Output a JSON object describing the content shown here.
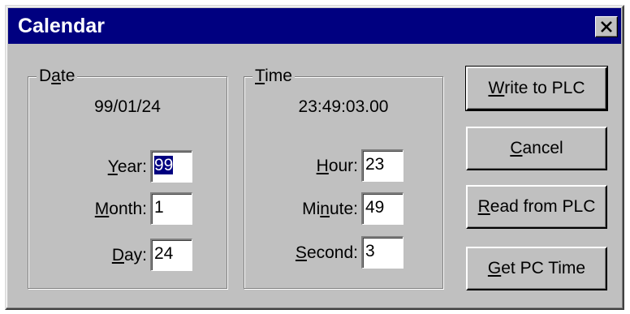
{
  "window": {
    "title": "Calendar"
  },
  "date_group": {
    "legend_prefix": "D",
    "legend_hotkey": "a",
    "legend_suffix": "te",
    "readout": "99/01/24",
    "fields": [
      {
        "label_pre": "",
        "hotkey": "Y",
        "label_post": "ear:",
        "value": "99"
      },
      {
        "label_pre": "",
        "hotkey": "M",
        "label_post": "onth:",
        "value": "1"
      },
      {
        "label_pre": "",
        "hotkey": "D",
        "label_post": "ay:",
        "value": "24"
      }
    ]
  },
  "time_group": {
    "legend_prefix": "",
    "legend_hotkey": "T",
    "legend_suffix": "ime",
    "readout": "23:49:03.00",
    "fields": [
      {
        "label_pre": "",
        "hotkey": "H",
        "label_post": "our:",
        "value": "23"
      },
      {
        "label_pre": "Mi",
        "hotkey": "n",
        "label_post": "ute:",
        "value": "49"
      },
      {
        "label_pre": "",
        "hotkey": "S",
        "label_post": "econd:",
        "value": "3"
      }
    ]
  },
  "buttons": [
    {
      "pre": "",
      "hotkey": "W",
      "post": "rite to PLC"
    },
    {
      "pre": "",
      "hotkey": "C",
      "post": "ancel"
    },
    {
      "pre": "",
      "hotkey": "R",
      "post": "ead from PLC"
    },
    {
      "pre": "",
      "hotkey": "G",
      "post": "et PC Time"
    }
  ],
  "icons": {
    "close": "close-icon"
  }
}
